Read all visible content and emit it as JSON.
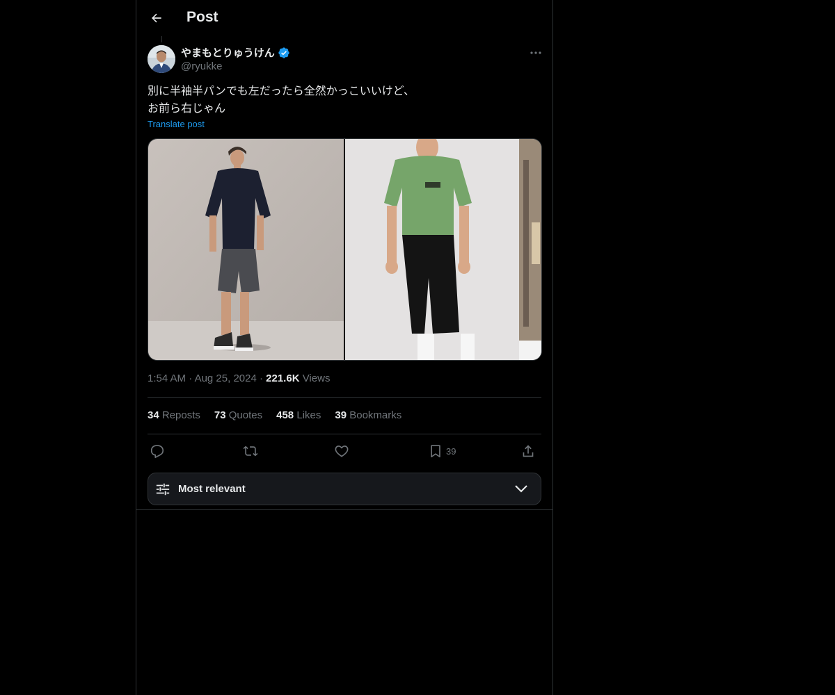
{
  "header": {
    "title": "Post"
  },
  "author": {
    "name": "やまもとりゅうけん",
    "handle": "@ryukke"
  },
  "post": {
    "lines": [
      "別に半袖半パンでも左だったら全然かっこいいけど、",
      "お前ら右じゃん"
    ],
    "translate_label": "Translate post",
    "time": "1:54 AM",
    "date": "Aug 25, 2024",
    "views_count": "221.6K",
    "views_label": "Views"
  },
  "stats": {
    "reposts": {
      "count": "34",
      "label": "Reposts"
    },
    "quotes": {
      "count": "73",
      "label": "Quotes"
    },
    "likes": {
      "count": "458",
      "label": "Likes"
    },
    "bookmarks": {
      "count": "39",
      "label": "Bookmarks"
    }
  },
  "actions": {
    "reply_icon": "reply-icon",
    "repost_icon": "repost-icon",
    "like_icon": "heart-icon",
    "bookmark_icon": "bookmark-icon",
    "bookmark_count": "39",
    "share_icon": "share-icon"
  },
  "sort": {
    "label": "Most relevant"
  },
  "colors": {
    "background": "#000000",
    "accent": "#1d9bf0",
    "muted": "#71767b",
    "border": "#2f3336"
  }
}
